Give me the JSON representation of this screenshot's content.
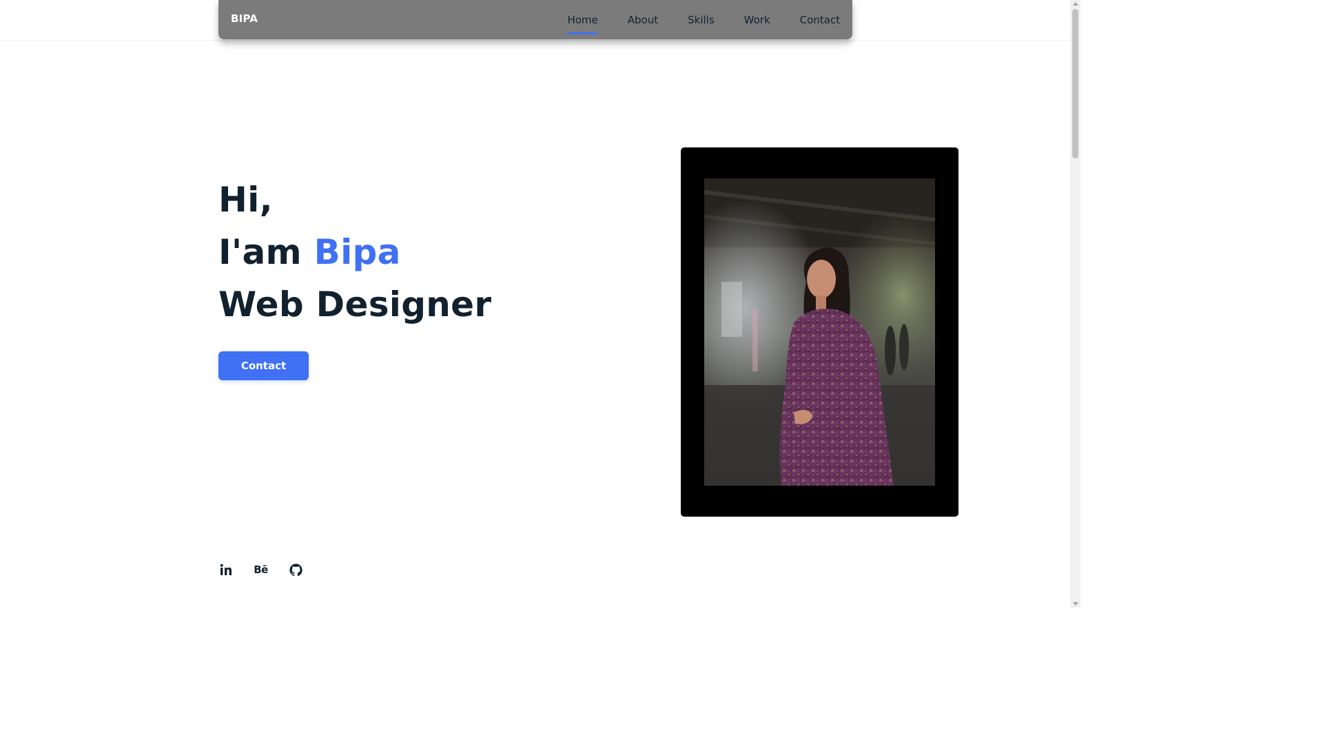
{
  "header": {
    "logo": "BIPA",
    "nav": [
      {
        "label": "Home",
        "active": true
      },
      {
        "label": "About",
        "active": false
      },
      {
        "label": "Skills",
        "active": false
      },
      {
        "label": "Work",
        "active": false
      },
      {
        "label": "Contact",
        "active": false
      }
    ]
  },
  "hero": {
    "greeting": "Hi,",
    "intro_prefix": "I'am ",
    "name": "Bipa",
    "role": "Web Designer",
    "button_label": "Contact"
  },
  "photo": {
    "description_icon": "portrait-photo"
  },
  "socials": [
    {
      "icon": "linkedin-icon",
      "label": "in"
    },
    {
      "icon": "behance-icon",
      "label": "Bē"
    },
    {
      "icon": "github-icon",
      "label": ""
    }
  ],
  "colors": {
    "accent": "#4070f4",
    "text": "#12212e",
    "navbar": "#7b7b7b",
    "photo_frame": "#000000"
  }
}
